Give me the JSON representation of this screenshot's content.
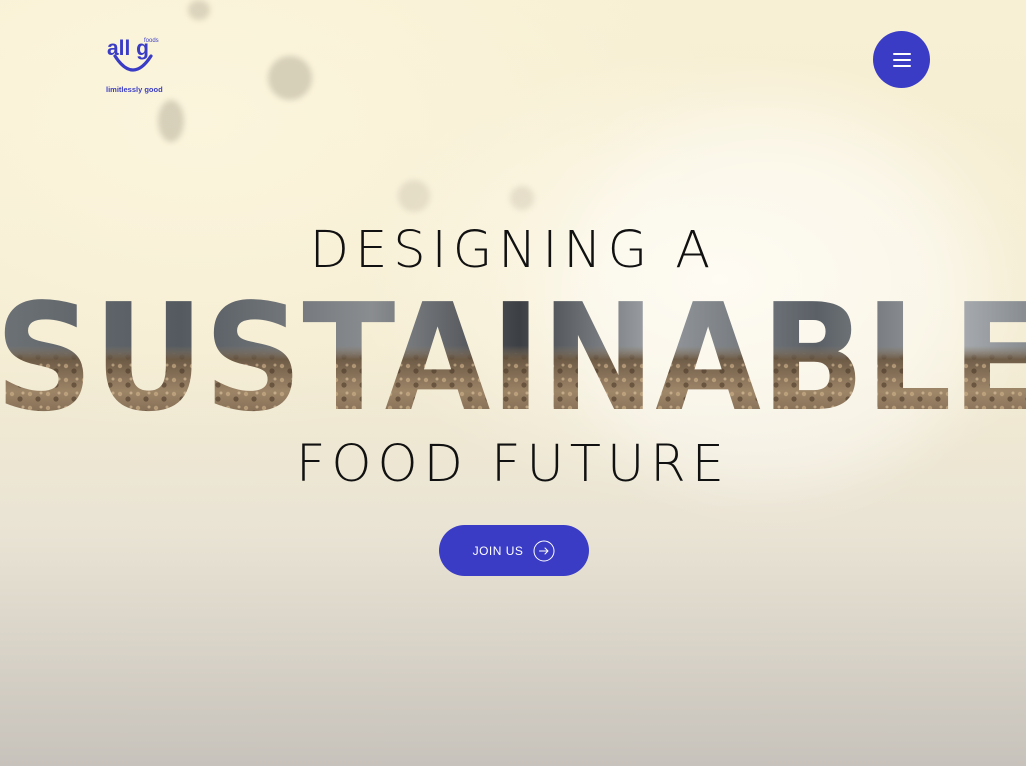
{
  "brand": {
    "logo_main": "all g",
    "logo_superscript": "foods",
    "tagline": "limitlessly good"
  },
  "header": {
    "menu_icon": "hamburger-menu-icon"
  },
  "hero": {
    "line_top": "DESIGNING A",
    "line_mid": "SUSTAINABLE",
    "line_bottom": "FOOD FUTURE",
    "cta_label": "JOIN US",
    "cta_icon": "arrow-right-circle-icon"
  },
  "colors": {
    "accent": "#3a3cc6",
    "headline_text": "#111111",
    "background": "#f4ecd2"
  }
}
